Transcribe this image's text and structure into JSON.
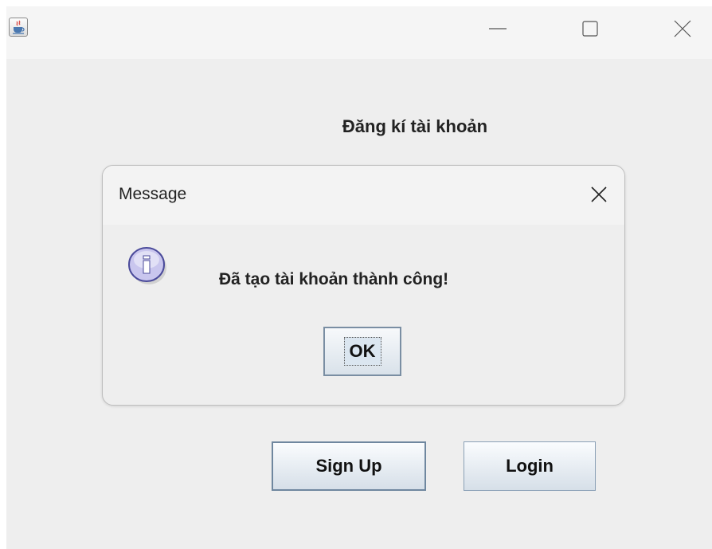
{
  "window": {
    "icon": "java-app-icon",
    "minimize_icon": "minimize-icon",
    "maximize_icon": "maximize-icon",
    "close_icon": "close-icon"
  },
  "form": {
    "title": "Đăng kí tài khoản",
    "signup_label": "Sign Up",
    "login_label": "Login"
  },
  "dialog": {
    "title": "Message",
    "icon": "info-icon",
    "message": "Đã tạo tài khoản thành công!",
    "ok_label": "OK"
  }
}
